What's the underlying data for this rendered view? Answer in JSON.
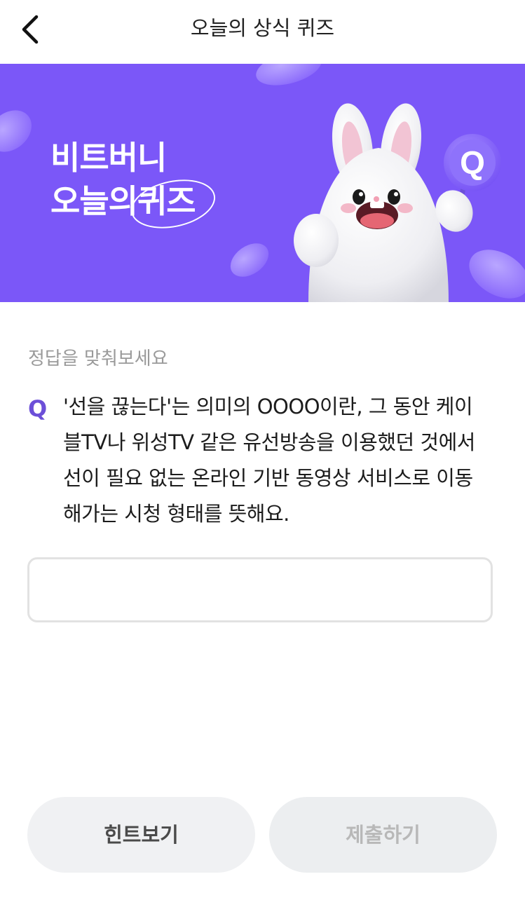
{
  "header": {
    "title": "오늘의 상식 퀴즈",
    "back_icon": "chevron-left-icon"
  },
  "banner": {
    "title_line1": "비트버니",
    "title_line2_prefix": "오늘의",
    "title_line2_circled": "퀴즈",
    "background_color": "#7b57f8",
    "badge_letter": "Q"
  },
  "quiz": {
    "prompt": "정답을 맞춰보세요",
    "q_mark": "Q",
    "question_lines": [
      "'선을 끊는다'는 의미의 OOOO이란, 그 동안 케이",
      "블TV나 위성TV 같은 유선방송을 이용했던 것에서",
      "선이 필요 없는 온라인 기반 동영상 서비스로 이동",
      "해가는 시청 형태를 뜻해요."
    ],
    "answer_value": "",
    "answer_placeholder": ""
  },
  "buttons": {
    "hint_label": "힌트보기",
    "submit_label": "제출하기"
  },
  "colors": {
    "accent": "#6c4fd8",
    "banner": "#7b57f8"
  }
}
